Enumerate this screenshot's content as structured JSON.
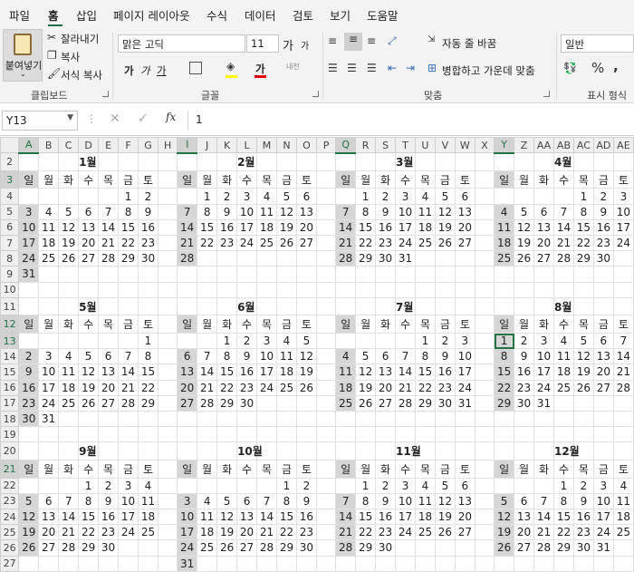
{
  "menu_tabs": [
    "파일",
    "홈",
    "삽입",
    "페이지 레이아웃",
    "수식",
    "데이터",
    "검토",
    "보기",
    "도움말"
  ],
  "clipboard": {
    "paste": "붙여넣기",
    "cut": "잘라내기",
    "copy": "복사",
    "format_painter": "서식 복사",
    "group": "클립보드"
  },
  "font": {
    "name": "맑은 고딕",
    "size": "11",
    "bold": "가",
    "italic": "가",
    "underline": "가",
    "font_color": "가",
    "grow": "가",
    "shrink": "가",
    "phonetic": "내천",
    "group": "글꼴"
  },
  "alignment": {
    "wrap": "자동 줄 바꿈",
    "merge": "병합하고 가운데 맞춤",
    "group": "맞춤"
  },
  "number": {
    "format": "일반",
    "group": "표시 형식"
  },
  "formula_bar": {
    "name_box": "Y13",
    "value": "1"
  },
  "sheet": {
    "active_cell": "Y13",
    "columns": [
      "A",
      "B",
      "C",
      "D",
      "E",
      "F",
      "G",
      "H",
      "I",
      "J",
      "K",
      "L",
      "M",
      "N",
      "O",
      "P",
      "Q",
      "R",
      "S",
      "T",
      "U",
      "V",
      "W",
      "X",
      "Y",
      "Z",
      "AA",
      "AB",
      "AC",
      "AD",
      "AE"
    ],
    "rows": [
      [
        "",
        "",
        "",
        "1월",
        "",
        "",
        "",
        "",
        "",
        "",
        "",
        "2월",
        "",
        "",
        "",
        "",
        "",
        "",
        "",
        "3월",
        "",
        "",
        "",
        "",
        "",
        "",
        "",
        "4월",
        "",
        "",
        ""
      ],
      [
        "일",
        "월",
        "화",
        "수",
        "목",
        "금",
        "토",
        "",
        "일",
        "월",
        "화",
        "수",
        "목",
        "금",
        "토",
        "",
        "일",
        "월",
        "화",
        "수",
        "목",
        "금",
        "토",
        "",
        "일",
        "월",
        "화",
        "수",
        "목",
        "금",
        "토"
      ],
      [
        "",
        "",
        "",
        "",
        "",
        "1",
        "2",
        "",
        "",
        "1",
        "2",
        "3",
        "4",
        "5",
        "6",
        "",
        "",
        "1",
        "2",
        "3",
        "4",
        "5",
        "6",
        "",
        "",
        "",
        "",
        "",
        "1",
        "2",
        "3"
      ],
      [
        "3",
        "4",
        "5",
        "6",
        "7",
        "8",
        "9",
        "",
        "7",
        "8",
        "9",
        "10",
        "11",
        "12",
        "13",
        "",
        "7",
        "8",
        "9",
        "10",
        "11",
        "12",
        "13",
        "",
        "4",
        "5",
        "6",
        "7",
        "8",
        "9",
        "10"
      ],
      [
        "10",
        "11",
        "12",
        "13",
        "14",
        "15",
        "16",
        "",
        "14",
        "15",
        "16",
        "17",
        "18",
        "19",
        "20",
        "",
        "14",
        "15",
        "16",
        "17",
        "18",
        "19",
        "20",
        "",
        "11",
        "12",
        "13",
        "14",
        "15",
        "16",
        "17"
      ],
      [
        "17",
        "18",
        "19",
        "20",
        "21",
        "22",
        "23",
        "",
        "21",
        "22",
        "23",
        "24",
        "25",
        "26",
        "27",
        "",
        "21",
        "22",
        "23",
        "24",
        "25",
        "26",
        "27",
        "",
        "18",
        "19",
        "20",
        "21",
        "22",
        "23",
        "24"
      ],
      [
        "24",
        "25",
        "26",
        "27",
        "28",
        "29",
        "30",
        "",
        "28",
        "",
        "",
        "",
        "",
        "",
        "",
        "",
        "28",
        "29",
        "30",
        "31",
        "",
        "",
        "",
        "",
        "25",
        "26",
        "27",
        "28",
        "29",
        "30",
        ""
      ],
      [
        "31",
        "",
        "",
        "",
        "",
        "",
        "",
        "",
        "",
        "",
        "",
        "",
        "",
        "",
        "",
        "",
        "",
        "",
        "",
        "",
        "",
        "",
        "",
        "",
        "",
        "",
        "",
        "",
        "",
        "",
        ""
      ],
      [
        "",
        "",
        "",
        "",
        "",
        "",
        "",
        "",
        "",
        "",
        "",
        "",
        "",
        "",
        "",
        "",
        "",
        "",
        "",
        "",
        "",
        "",
        "",
        "",
        "",
        "",
        "",
        "",
        "",
        "",
        ""
      ],
      [
        "",
        "",
        "",
        "5월",
        "",
        "",
        "",
        "",
        "",
        "",
        "",
        "6월",
        "",
        "",
        "",
        "",
        "",
        "",
        "",
        "7월",
        "",
        "",
        "",
        "",
        "",
        "",
        "",
        "8월",
        "",
        "",
        ""
      ],
      [
        "일",
        "월",
        "화",
        "수",
        "목",
        "금",
        "토",
        "",
        "일",
        "월",
        "화",
        "수",
        "목",
        "금",
        "토",
        "",
        "일",
        "월",
        "화",
        "수",
        "목",
        "금",
        "토",
        "",
        "일",
        "월",
        "화",
        "수",
        "목",
        "금",
        "토"
      ],
      [
        "",
        "",
        "",
        "",
        "",
        "",
        "1",
        "",
        "",
        "",
        "1",
        "2",
        "3",
        "4",
        "5",
        "",
        "",
        "",
        "",
        "",
        "1",
        "2",
        "3",
        "",
        "1",
        "2",
        "3",
        "4",
        "5",
        "6",
        "7"
      ],
      [
        "2",
        "3",
        "4",
        "5",
        "6",
        "7",
        "8",
        "",
        "6",
        "7",
        "8",
        "9",
        "10",
        "11",
        "12",
        "",
        "4",
        "5",
        "6",
        "7",
        "8",
        "9",
        "10",
        "",
        "8",
        "9",
        "10",
        "11",
        "12",
        "13",
        "14"
      ],
      [
        "9",
        "10",
        "11",
        "12",
        "13",
        "14",
        "15",
        "",
        "13",
        "14",
        "15",
        "16",
        "17",
        "18",
        "19",
        "",
        "11",
        "12",
        "13",
        "14",
        "15",
        "16",
        "17",
        "",
        "15",
        "16",
        "17",
        "18",
        "19",
        "20",
        "21"
      ],
      [
        "16",
        "17",
        "18",
        "19",
        "20",
        "21",
        "22",
        "",
        "20",
        "21",
        "22",
        "23",
        "24",
        "25",
        "26",
        "",
        "18",
        "19",
        "20",
        "21",
        "22",
        "23",
        "24",
        "",
        "22",
        "23",
        "24",
        "25",
        "26",
        "27",
        "28"
      ],
      [
        "23",
        "24",
        "25",
        "26",
        "27",
        "28",
        "29",
        "",
        "27",
        "28",
        "29",
        "30",
        "",
        "",
        "",
        "",
        "25",
        "26",
        "27",
        "28",
        "29",
        "30",
        "31",
        "",
        "29",
        "30",
        "31",
        "",
        "",
        "",
        ""
      ],
      [
        "30",
        "31",
        "",
        "",
        "",
        "",
        "",
        "",
        "",
        "",
        "",
        "",
        "",
        "",
        "",
        "",
        "",
        "",
        "",
        "",
        "",
        "",
        "",
        "",
        "",
        "",
        "",
        "",
        "",
        "",
        ""
      ],
      [
        "",
        "",
        "",
        "",
        "",
        "",
        "",
        "",
        "",
        "",
        "",
        "",
        "",
        "",
        "",
        "",
        "",
        "",
        "",
        "",
        "",
        "",
        "",
        "",
        "",
        "",
        "",
        "",
        "",
        "",
        ""
      ],
      [
        "",
        "",
        "",
        "9월",
        "",
        "",
        "",
        "",
        "",
        "",
        "",
        "10월",
        "",
        "",
        "",
        "",
        "",
        "",
        "",
        "11월",
        "",
        "",
        "",
        "",
        "",
        "",
        "",
        "12월",
        "",
        "",
        ""
      ],
      [
        "일",
        "월",
        "화",
        "수",
        "목",
        "금",
        "토",
        "",
        "일",
        "월",
        "화",
        "수",
        "목",
        "금",
        "토",
        "",
        "일",
        "월",
        "화",
        "수",
        "목",
        "금",
        "토",
        "",
        "일",
        "월",
        "화",
        "수",
        "목",
        "금",
        "토"
      ],
      [
        "",
        "",
        "",
        "1",
        "2",
        "3",
        "4",
        "",
        "",
        "",
        "",
        "",
        "",
        "1",
        "2",
        "",
        "",
        "1",
        "2",
        "3",
        "4",
        "5",
        "6",
        "",
        "",
        "",
        "",
        "1",
        "2",
        "3",
        "4"
      ],
      [
        "5",
        "6",
        "7",
        "8",
        "9",
        "10",
        "11",
        "",
        "3",
        "4",
        "5",
        "6",
        "7",
        "8",
        "9",
        "",
        "7",
        "8",
        "9",
        "10",
        "11",
        "12",
        "13",
        "",
        "5",
        "6",
        "7",
        "8",
        "9",
        "10",
        "11"
      ],
      [
        "12",
        "13",
        "14",
        "15",
        "16",
        "17",
        "18",
        "",
        "10",
        "11",
        "12",
        "13",
        "14",
        "15",
        "16",
        "",
        "14",
        "15",
        "16",
        "17",
        "18",
        "19",
        "20",
        "",
        "12",
        "13",
        "14",
        "15",
        "16",
        "17",
        "18"
      ],
      [
        "19",
        "20",
        "21",
        "22",
        "23",
        "24",
        "25",
        "",
        "17",
        "18",
        "19",
        "20",
        "21",
        "22",
        "23",
        "",
        "21",
        "22",
        "23",
        "24",
        "25",
        "26",
        "27",
        "",
        "19",
        "20",
        "21",
        "22",
        "23",
        "24",
        "25"
      ],
      [
        "26",
        "27",
        "28",
        "29",
        "30",
        "",
        "",
        "",
        "24",
        "25",
        "26",
        "27",
        "28",
        "29",
        "30",
        "",
        "28",
        "29",
        "30",
        "",
        "",
        "",
        "",
        "",
        "26",
        "27",
        "28",
        "29",
        "30",
        "31",
        ""
      ],
      [
        "",
        "",
        "",
        "",
        "",
        "",
        "",
        "",
        "31",
        "",
        "",
        "",
        "",
        "",
        "",
        "",
        "",
        "",
        "",
        "",
        "",
        "",
        "",
        "",
        "",
        "",
        "",
        "",
        "",
        "",
        ""
      ]
    ]
  },
  "colors": {
    "excel_green": "#217346",
    "sunday_fill": "#d6d6d6",
    "ribbon_bg": "#f3f3f3"
  },
  "icons": [
    "paste-icon",
    "scissors-icon",
    "copy-icon",
    "format-painter-icon",
    "wrap-text-icon",
    "merge-icon",
    "cancel-icon",
    "check-icon",
    "fx-icon"
  ]
}
